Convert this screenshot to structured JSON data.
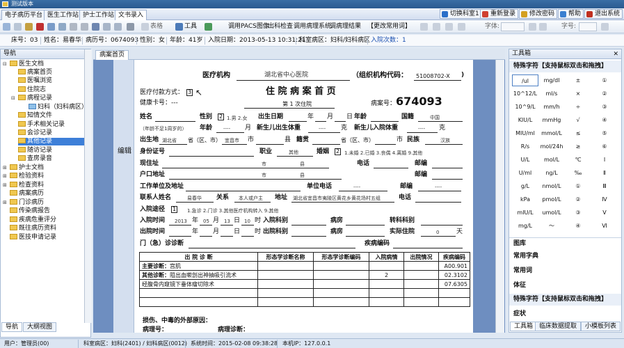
{
  "window": {
    "title": "测试版本"
  },
  "tabs": [
    "电子病历平台",
    "医生工作站",
    "护士工作站",
    "文书录入"
  ],
  "right_buttons": [
    {
      "label": "切换科室1",
      "color": "#2a6fc9"
    },
    {
      "label": "重新登录",
      "color": "#d04030"
    },
    {
      "label": "修改密码",
      "color": "#d4a020"
    },
    {
      "label": "帮助",
      "color": "#3a7fd0"
    },
    {
      "label": "退出系统",
      "color": "#c03020"
    }
  ],
  "toolbar": {
    "table_label": "表格",
    "tools_label": "工具",
    "links": [
      "调用PACS图像",
      "出科检查",
      "调用病理系统",
      "调病理结果",
      "【更改常用词】"
    ],
    "font_label": "字体:",
    "size_label": "字号:"
  },
  "patient": {
    "bed": "床号：03",
    "name": "姓名：易春华",
    "record": "病历号：0674093",
    "sex": "性别：女",
    "age": "年龄：41岁",
    "admit": "入院日期：2013-05-13 10:31:21",
    "dept": "科室病区：妇科/妇科病区",
    "times": "入院次数：1"
  },
  "left": {
    "header": "导航",
    "tree": [
      "医生文档",
      "病案首页",
      "医嘱浏览",
      "住院志",
      "病程记录",
      "妇科（妇科病区）",
      "知情文件",
      "手术相关记录",
      "会诊记录",
      "其他记录",
      "随访记录",
      "查房录音",
      "护士文档",
      "检验资料",
      "检查资料",
      "病案病历",
      "门诊病历",
      "传染病报告",
      "疾病危重评分",
      "既往病历资料",
      "医技申请记录"
    ],
    "bottom_tabs": [
      "导航",
      "大纲视图"
    ]
  },
  "doc": {
    "tab": "病案首页",
    "edit_label": "编辑",
    "org_label": "医疗机构",
    "org": "湖北省中心医院",
    "org_code_label": "（组织机构代码：",
    "org_code": "51008702-X",
    "pay_label": "医疗付款方式：",
    "pay": "3",
    "title": "住 院 病 案 首 页",
    "health_card": "健康卡号：---",
    "times_text": "第 1 次住院",
    "rec_label": "病案号：",
    "rec_no": "674093",
    "name_label": "姓名",
    "sex_label": "性别",
    "sex_val": "2",
    "sex_opts": "1.男 2.女",
    "birth_label": "出生日期",
    "y": "年",
    "m": "月",
    "d": "日",
    "age_label": "年龄",
    "nation_label": "国籍",
    "nation": "中国",
    "infant_note": "（年龄不足1周岁的）",
    "age2_label": "年龄",
    "age2_val": "----",
    "month": "月",
    "nb_w": "新生儿出生体重",
    "nb_w_val": "----",
    "g": "克",
    "nb_in": "新生儿入院体重",
    "nb_in_val": "----",
    "birthplace_label": "出生地",
    "birthplace": "湖北省",
    "prov": "省（区、市）",
    "city": "宜昌市",
    "cityu": "市",
    "county": "县",
    "native_label": "籍贯",
    "prov2": "省（区、市）",
    "cityu2": "市",
    "ethnic_label": "民族",
    "ethnic": "汉族",
    "id_label": "身份证号",
    "job_label": "职业",
    "job": "其他",
    "marry_label": "婚姻",
    "marry_val": "2",
    "marry_opts": "1.未婚 2.已婚 3.丧偶 4.离婚 9.其他",
    "addr_label": "现住址",
    "addr_city": "市",
    "addr_county": "县",
    "phone_label": "电话",
    "zip_label": "邮编",
    "hukou_label": "户口地址",
    "hk_city": "市",
    "hk_county": "县",
    "work_label": "工作单位及地址",
    "unit_phone_label": "单位电话",
    "unit_phone": "----",
    "unit_zip_label": "邮编",
    "unit_zip": "----",
    "contact_label": "联系人姓名",
    "contact": "易春华",
    "rel_label": "关系",
    "rel": "本人或户主",
    "caddr_label": "地址",
    "caddr": "湖北省宜昌市夷陵区黄花乡黄花场村五组",
    "cphone_label": "电话",
    "route_label": "入院途径",
    "route_val": "1",
    "route_opts": "1.急诊 2.门诊 3.其他医疗机构转入 9.其他",
    "in_time_label": "入院时间",
    "in_y": "2013",
    "in_m": "05",
    "in_d": "13",
    "in_h": "10",
    "hr": "时",
    "in_dept_label": "入院科别",
    "ward_label": "病房",
    "trans_label": "转科科别",
    "out_time_label": "出院时间",
    "out_dept_label": "出院科别",
    "ward2_label": "病房",
    "days_label": "实际住院",
    "days": "0",
    "days_u": "天",
    "opd_label": "门（急）诊诊断",
    "dcode_label": "疾病编码",
    "dx_headers": [
      "出 院 诊 断",
      "形态学诊断名称",
      "形态学诊断编码",
      "入院病情",
      "出院情况",
      "疾病编码"
    ],
    "dx_rows": [
      {
        "label": "主要诊断：",
        "dx": "宫肌",
        "cond": "",
        "code": "A00.901"
      },
      {
        "label": "其他诊断：",
        "dx": "阻出血嗽剖出神抽吸引流术",
        "cond": "2",
        "code": "02.3102"
      },
      {
        "label": "",
        "dx": "经腹骨内窥镜下垂体瘤切除术",
        "cond": "",
        "code": "07.6305"
      }
    ],
    "injury_label": "损伤、中毒的外部原因：",
    "path_no_label": "病理号：",
    "path_dx_label": "病理诊断："
  },
  "right": {
    "header": "工具箱",
    "special_title": "特殊字符【支持鼠标双击和拖拽】",
    "grid": [
      [
        "/ul",
        "mg/dl",
        "±",
        "①"
      ],
      [
        "10^12/L",
        "ml/s",
        "×",
        "②"
      ],
      [
        "10^9/L",
        "mm/h",
        "÷",
        "③"
      ],
      [
        "KIU/L",
        "mmHg",
        "√",
        "④"
      ],
      [
        "MIU/ml",
        "mmol/L",
        "≤",
        "⑤"
      ],
      [
        "R/s",
        "mol/24h",
        "≥",
        "⑥"
      ],
      [
        "U/L",
        "mol/L",
        "℃",
        "Ⅰ"
      ],
      [
        "U/ml",
        "ng/L",
        "‰",
        "Ⅱ"
      ],
      [
        "g/L",
        "nmol/L",
        "①",
        "Ⅲ"
      ],
      [
        "kPa",
        "pmol/L",
        "②",
        "Ⅳ"
      ],
      [
        "mIU/L",
        "umol/L",
        "③",
        "Ⅴ"
      ],
      [
        "mg/L",
        "～",
        "④",
        "Ⅵ"
      ]
    ],
    "sections": [
      "图库",
      "常用字典",
      "常用词",
      "体征",
      "特殊字符【支持鼠标双击和拖拽】",
      "症状"
    ],
    "bottom_tabs": [
      "工具箱",
      "临床数据提取",
      "小模板列表"
    ]
  },
  "status": {
    "user": "用户：管理员(00)",
    "dept": "科室病区：妇科(2401) / 妇科病区(0012)",
    "time": "系统时间：2015-02-08 09:38:28",
    "ip": "本机IP：127.0.0.1"
  }
}
